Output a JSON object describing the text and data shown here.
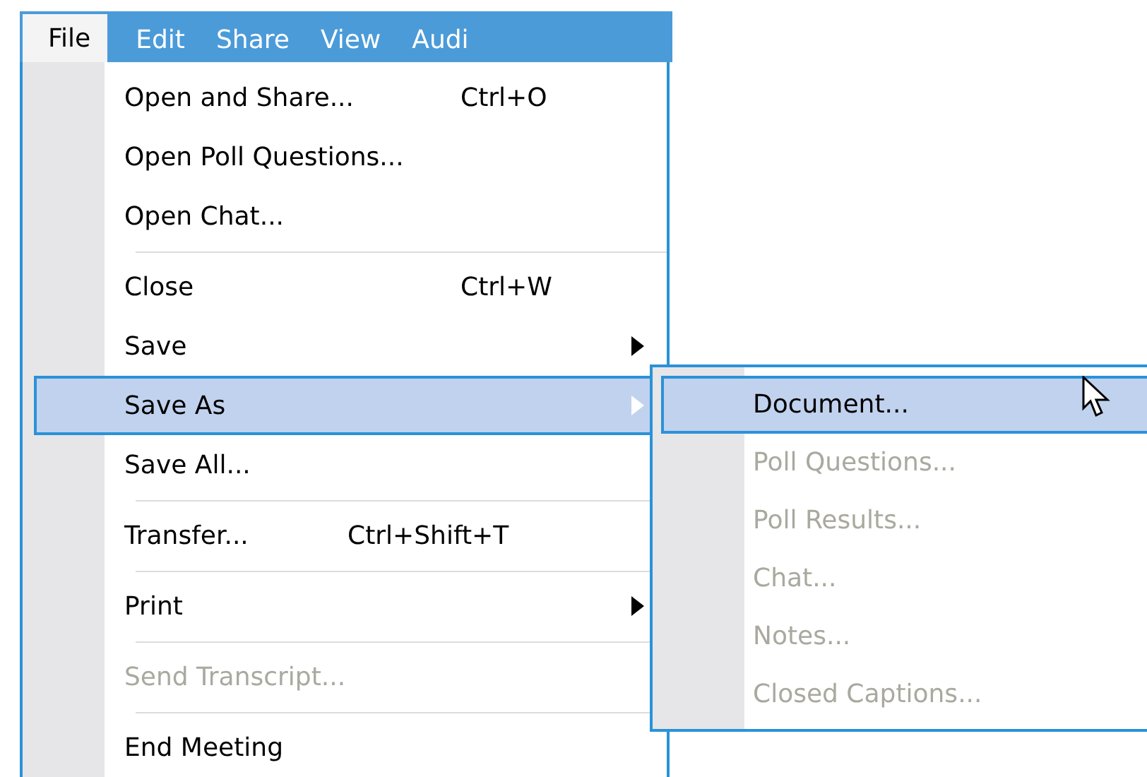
{
  "menu_bar": {
    "items": [
      {
        "label": "File",
        "selected": true
      },
      {
        "label": "Edit",
        "selected": false
      },
      {
        "label": "Share",
        "selected": false
      },
      {
        "label": "View",
        "selected": false
      },
      {
        "label": "Audi",
        "selected": false
      }
    ]
  },
  "file_menu": {
    "items": [
      {
        "kind": "item",
        "label": "Open and Share...",
        "shortcut": "Ctrl+O",
        "submenu": false,
        "disabled": false,
        "selected": false
      },
      {
        "kind": "item",
        "label": "Open Poll Questions...",
        "submenu": false,
        "disabled": false,
        "selected": false
      },
      {
        "kind": "item",
        "label": "Open Chat...",
        "submenu": false,
        "disabled": false,
        "selected": false
      },
      {
        "kind": "separator"
      },
      {
        "kind": "item",
        "label": "Close",
        "shortcut": "Ctrl+W",
        "submenu": false,
        "disabled": false,
        "selected": false
      },
      {
        "kind": "item",
        "label": "Save",
        "submenu": true,
        "disabled": false,
        "selected": false
      },
      {
        "kind": "item",
        "label": "Save As",
        "submenu": true,
        "disabled": false,
        "selected": true
      },
      {
        "kind": "item",
        "label": "Save All...",
        "submenu": false,
        "disabled": false,
        "selected": false
      },
      {
        "kind": "separator"
      },
      {
        "kind": "item",
        "label": "Transfer...",
        "shortcut": "Ctrl+Shift+T",
        "submenu": false,
        "disabled": false,
        "selected": false
      },
      {
        "kind": "separator"
      },
      {
        "kind": "item",
        "label": "Print",
        "submenu": true,
        "disabled": false,
        "selected": false
      },
      {
        "kind": "separator"
      },
      {
        "kind": "item",
        "label": "Send Transcript...",
        "submenu": false,
        "disabled": true,
        "selected": false
      },
      {
        "kind": "separator"
      },
      {
        "kind": "item",
        "label": "End Meeting",
        "submenu": false,
        "disabled": false,
        "selected": false
      }
    ]
  },
  "save_as_submenu": {
    "items": [
      {
        "kind": "item",
        "label": "Document...",
        "disabled": false,
        "selected": true
      },
      {
        "kind": "item",
        "label": "Poll Questions...",
        "disabled": true,
        "selected": false
      },
      {
        "kind": "item",
        "label": "Poll Results...",
        "disabled": true,
        "selected": false
      },
      {
        "kind": "item",
        "label": "Chat...",
        "disabled": true,
        "selected": false
      },
      {
        "kind": "item",
        "label": "Notes...",
        "disabled": true,
        "selected": false
      },
      {
        "kind": "item",
        "label": "Closed Captions...",
        "disabled": true,
        "selected": false
      }
    ]
  }
}
